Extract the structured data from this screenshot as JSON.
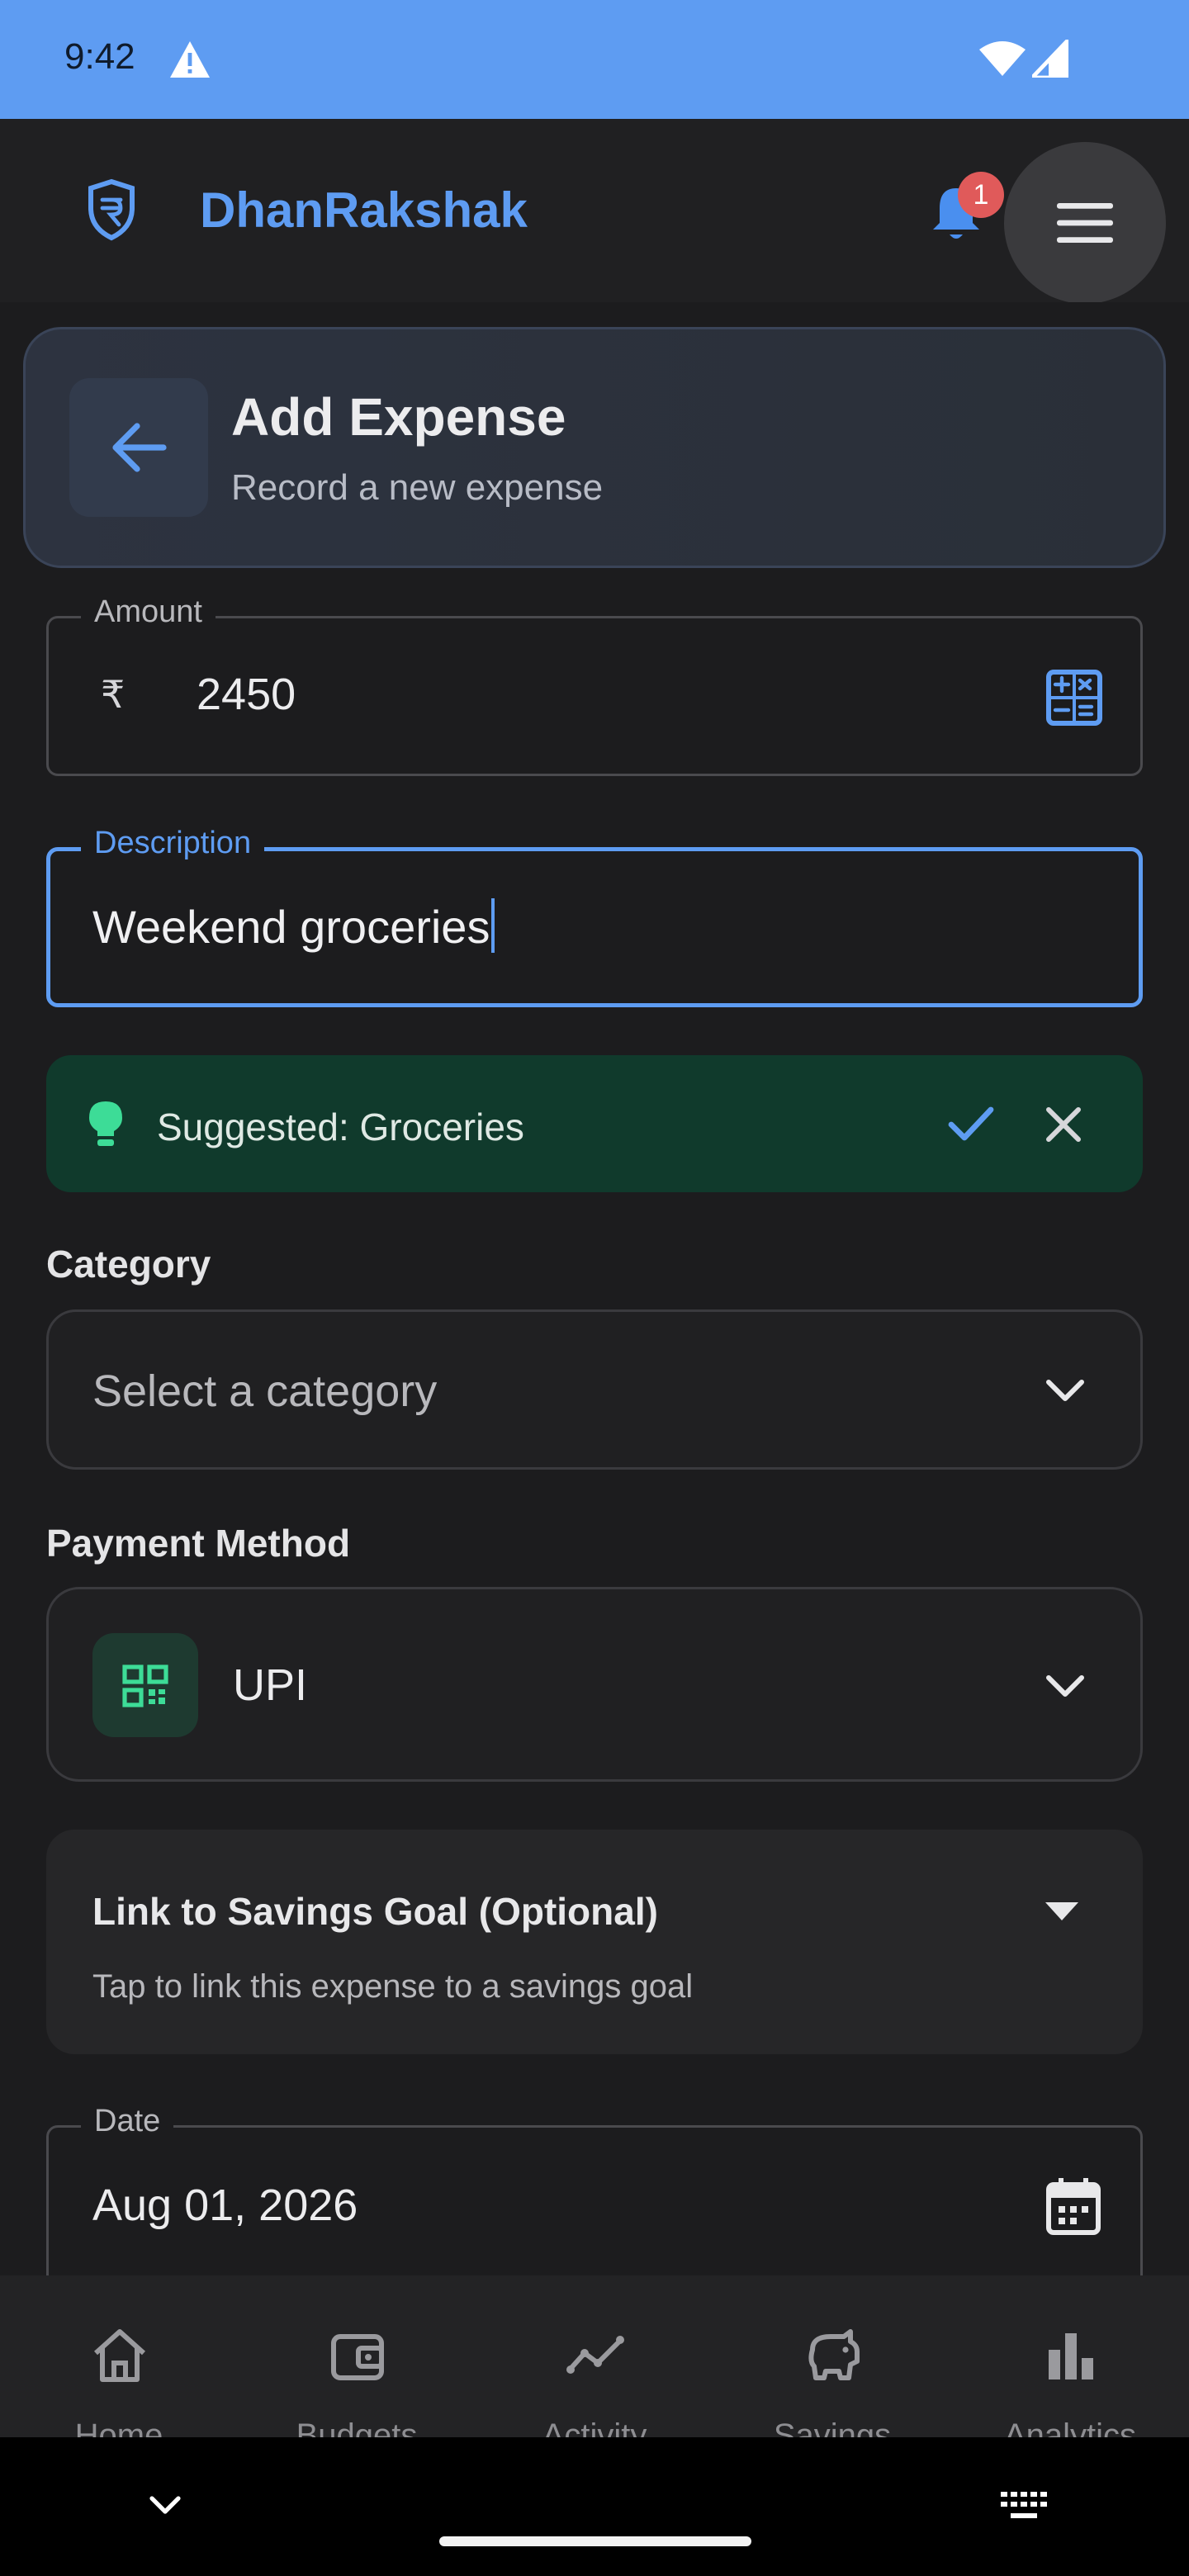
{
  "status_bar": {
    "time": "9:42"
  },
  "app_bar": {
    "title": "DhanRakshak",
    "notification_count": "1"
  },
  "header": {
    "title": "Add Expense",
    "subtitle": "Record a new expense"
  },
  "amount": {
    "label": "Amount",
    "currency_symbol": "₹",
    "value": "2450"
  },
  "description": {
    "label": "Description",
    "value": "Weekend groceries"
  },
  "suggestion": {
    "text": "Suggested: Groceries"
  },
  "category": {
    "label": "Category",
    "placeholder": "Select a category"
  },
  "payment": {
    "label": "Payment Method",
    "value": "UPI"
  },
  "savings_link": {
    "title": "Link to Savings Goal (Optional)",
    "description": "Tap to link this expense to a savings goal"
  },
  "date": {
    "label": "Date",
    "value": "Aug 01, 2026"
  },
  "bottom_nav": {
    "items": [
      {
        "label": "Home",
        "icon": "home-icon"
      },
      {
        "label": "Budgets",
        "icon": "wallet-icon"
      },
      {
        "label": "Activity",
        "icon": "activity-icon"
      },
      {
        "label": "Savings",
        "icon": "piggy-bank-icon"
      },
      {
        "label": "Analytics",
        "icon": "bar-chart-icon"
      }
    ]
  },
  "colors": {
    "status_bar": "#5e9cf2",
    "accent": "#5e9cf2",
    "background": "#1c1c1e",
    "suggestion_bg": "#103a2c",
    "suggestion_icon": "#3ddc97",
    "badge": "#e05a5a"
  }
}
